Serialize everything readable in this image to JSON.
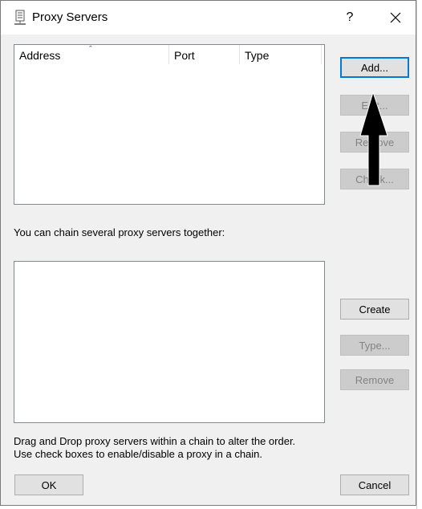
{
  "window": {
    "title": "Proxy Servers",
    "help_label": "?",
    "icon": "server-icon",
    "close_icon": "close-icon"
  },
  "proxy_list": {
    "columns": [
      {
        "label": "Address",
        "sorted": true
      },
      {
        "label": "Port"
      },
      {
        "label": "Type"
      }
    ],
    "rows": []
  },
  "proxy_buttons": {
    "add": "Add...",
    "edit": "Edit...",
    "remove": "Remove",
    "check": "Check..."
  },
  "chain": {
    "label": "You can chain several proxy servers together:",
    "items": []
  },
  "chain_buttons": {
    "create": "Create",
    "type": "Type...",
    "remove": "Remove"
  },
  "hints": {
    "line1": "Drag and Drop proxy servers within a chain to alter the order.",
    "line2": "Use check boxes to enable/disable a proxy in a chain."
  },
  "footer": {
    "ok": "OK",
    "cancel": "Cancel"
  },
  "colors": {
    "dialog_bg": "#f0f0f0",
    "accent": "#0078d7",
    "disabled_text": "#838383"
  }
}
